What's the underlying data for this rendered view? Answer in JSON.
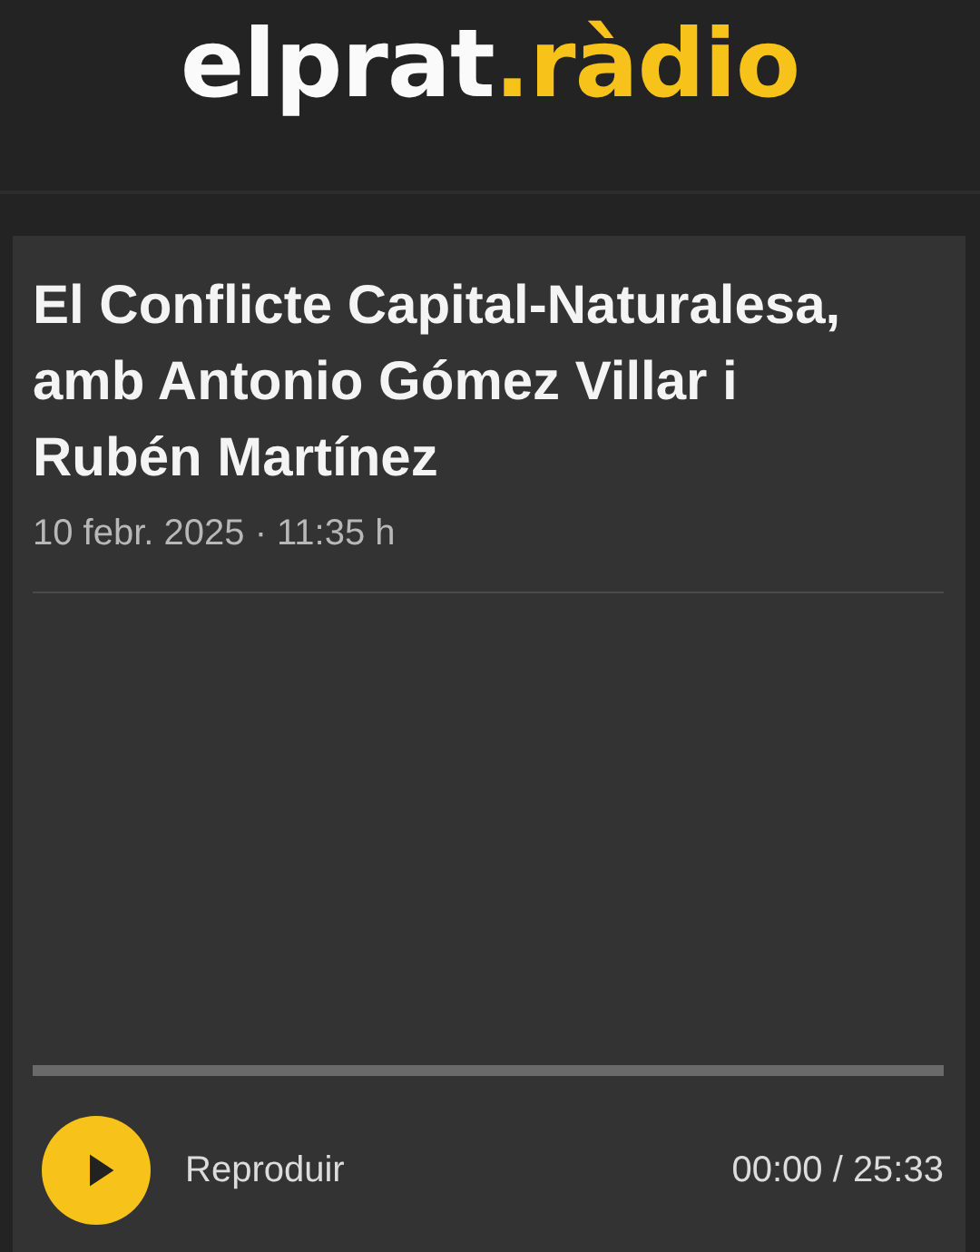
{
  "header": {
    "logo": {
      "main": "elprat",
      "accent": ".ràdio"
    }
  },
  "episode": {
    "title": "El Conflicte Capital-Naturalesa, amb Antonio Gómez Villar i Rubén Martínez",
    "date": "10 febr. 2025 · 11:35 h"
  },
  "player": {
    "playing": false,
    "level": 0,
    "button_label": "Reproduir",
    "time": "00:00 / 25:33"
  }
}
